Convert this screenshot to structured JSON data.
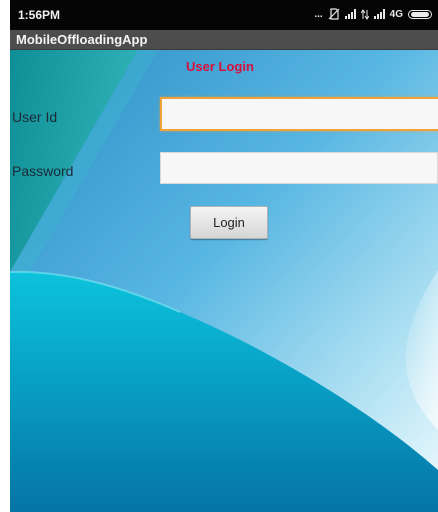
{
  "status_bar": {
    "time": "1:56PM",
    "dots": "...",
    "network_label": "4G"
  },
  "app": {
    "title": "MobileOffloadingApp"
  },
  "form": {
    "heading": "User Login",
    "user_id_label": "User Id",
    "user_id_value": "",
    "password_label": "Password",
    "password_value": "",
    "login_button": "Login"
  },
  "colors": {
    "heading": "#d6123c",
    "focus_border": "#f0a23a",
    "background_blue": "#3fa6d6",
    "background_cyan": "#12b6d0"
  }
}
